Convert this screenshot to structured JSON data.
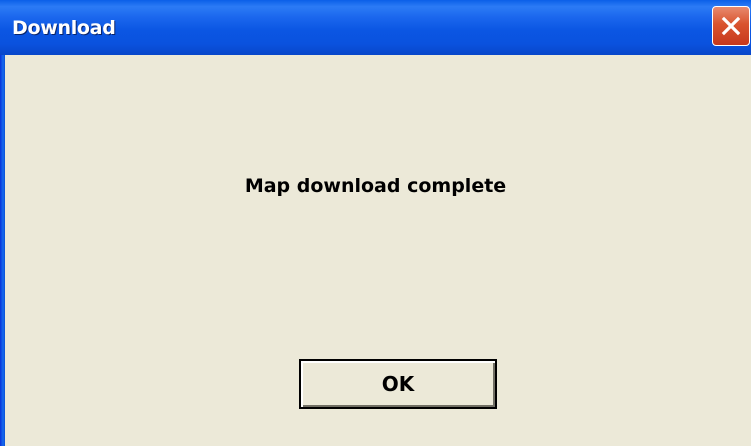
{
  "window": {
    "title": "Download",
    "close_icon": "close-icon"
  },
  "dialog": {
    "message": "Map download complete",
    "ok_label": "OK"
  },
  "colors": {
    "titlebar": "#0A52DE",
    "dialog_background": "#ECE9D8",
    "close_button": "#D9542F"
  }
}
